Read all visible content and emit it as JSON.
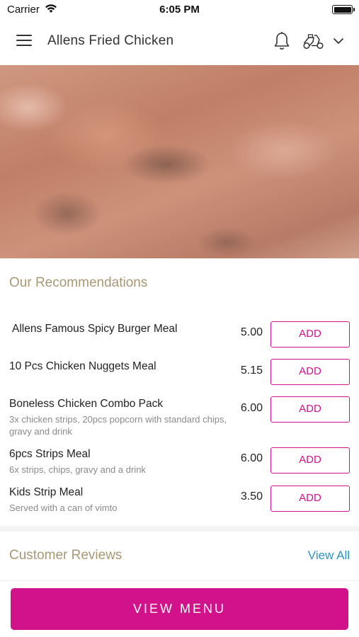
{
  "status_bar": {
    "carrier": "Carrier",
    "time": "6:05 PM"
  },
  "header": {
    "title": "Allens Fried Chicken"
  },
  "recommendations": {
    "title": "Our Recommendations",
    "items": [
      {
        "name": "Allens Famous Spicy Burger Meal",
        "description": "",
        "price": "5.00",
        "add_label": "ADD"
      },
      {
        "name": "10 Pcs Chicken Nuggets Meal",
        "description": "",
        "price": "5.15",
        "add_label": "ADD"
      },
      {
        "name": "Boneless Chicken Combo Pack",
        "description": "3x chicken strips, 20pcs popcorn with standard chips, gravy and drink",
        "price": "6.00",
        "add_label": "ADD"
      },
      {
        "name": "6pcs Strips Meal",
        "description": "6x strips, chips, gravy and a drink",
        "price": "6.00",
        "add_label": "ADD"
      },
      {
        "name": "Kids Strip Meal",
        "description": "Served with a can of vimto",
        "price": "3.50",
        "add_label": "ADD"
      }
    ]
  },
  "reviews": {
    "title": "Customer Reviews",
    "view_all_label": "View All"
  },
  "footer": {
    "view_menu_label": "VIEW MENU"
  },
  "colors": {
    "accent": "#d1128a",
    "section_title": "#a99774",
    "link": "#2a95bf"
  },
  "icons": [
    "menu-icon",
    "bell-icon",
    "scooter-icon",
    "chevron-down-icon",
    "wifi-icon",
    "battery-icon"
  ]
}
